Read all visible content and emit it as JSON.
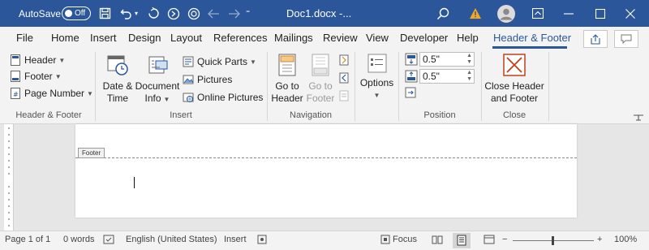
{
  "titlebar": {
    "autosave_label": "AutoSave",
    "autosave_state": "Off",
    "document_title": "Doc1.docx  -...",
    "icons": [
      "save-icon",
      "undo-icon",
      "redo-icon",
      "forward-icon",
      "refresh-icon",
      "back-arrow-icon",
      "forward-arrow-icon",
      "more-icon",
      "search-icon",
      "warning-icon",
      "avatar",
      "ribbon-display-icon",
      "minimize-icon",
      "maximize-icon",
      "close-icon"
    ],
    "accent": "#2b579a",
    "warning_color": "#f5a623"
  },
  "tabs": [
    "File",
    "Home",
    "Insert",
    "Design",
    "Layout",
    "References",
    "Mailings",
    "Review",
    "View",
    "Developer",
    "Help",
    "Header & Footer"
  ],
  "active_tab": "Header & Footer",
  "ribbon": {
    "header_footer": {
      "header": "Header",
      "footer": "Footer",
      "page_number": "Page Number",
      "label": "Header & Footer"
    },
    "insert": {
      "date_time_1": "Date &",
      "date_time_2": "Time",
      "doc_info_1": "Document",
      "doc_info_2": "Info",
      "quick_parts": "Quick Parts",
      "pictures": "Pictures",
      "online_pictures": "Online Pictures",
      "label": "Insert"
    },
    "navigation": {
      "goto_header_1": "Go to",
      "goto_header_2": "Header",
      "goto_footer_1": "Go to",
      "goto_footer_2": "Footer",
      "label": "Navigation"
    },
    "options": {
      "options": "Options"
    },
    "position": {
      "header_from_top": "0.5\"",
      "footer_from_bottom": "0.5\"",
      "label": "Position"
    },
    "close": {
      "close_1": "Close Header",
      "close_2": "and Footer",
      "label": "Close",
      "icon_color": "#c43e1c"
    }
  },
  "document": {
    "footer_tag": "Footer"
  },
  "status": {
    "page": "Page 1 of 1",
    "words": "0 words",
    "language": "English (United States)",
    "insert_mode": "Insert",
    "focus": "Focus",
    "zoom": "100%"
  }
}
